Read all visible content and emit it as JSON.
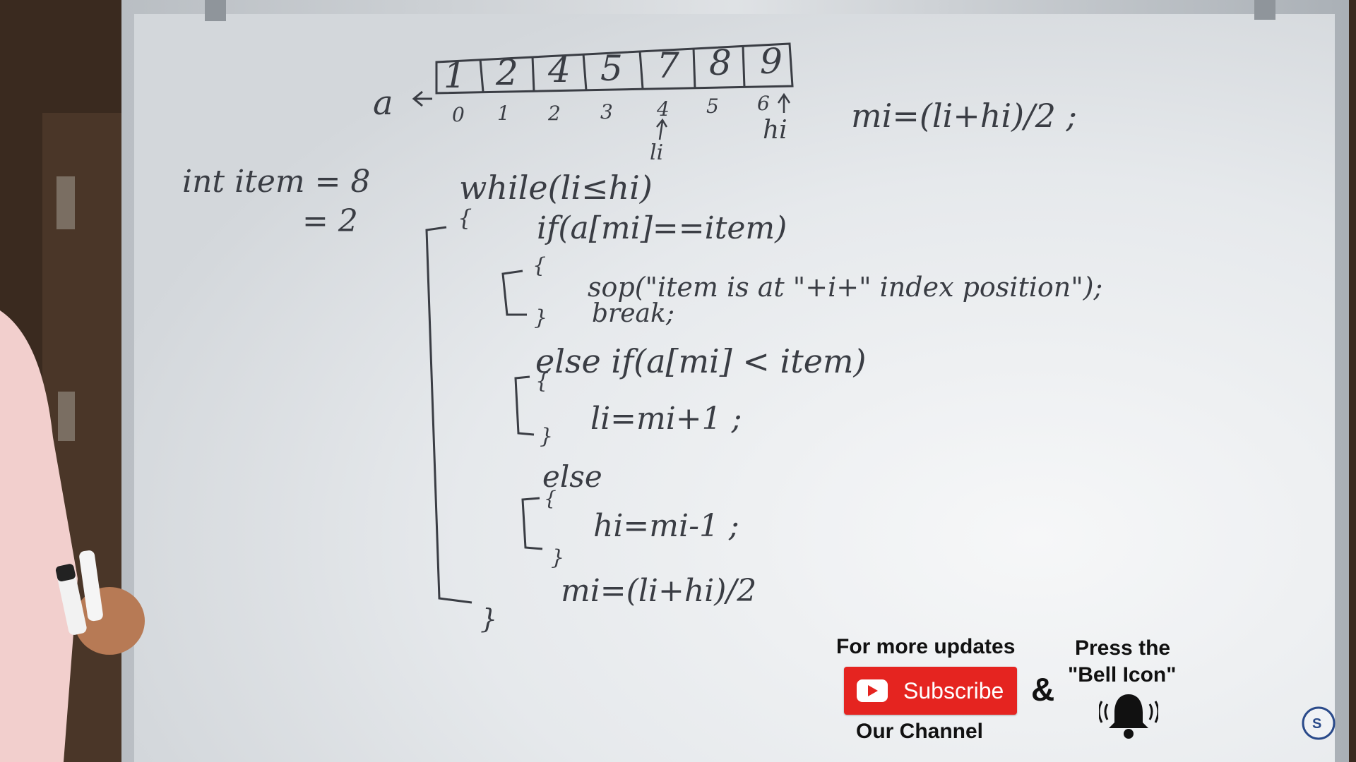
{
  "board": {
    "array_name": "a",
    "array_values": [
      "1",
      "2",
      "4",
      "5",
      "7",
      "8",
      "9"
    ],
    "array_indices": [
      "0",
      "1",
      "2",
      "3",
      "4",
      "5",
      "6"
    ],
    "pointer_li": "li",
    "pointer_hi": "hi",
    "mid_formula": "mi=(li+hi)/2 ;",
    "item_decl": "int item = 8",
    "item_alt": "= 2",
    "code": {
      "while_line": "while(li≤hi)",
      "open_brace": "{",
      "if_line": "if(a[mi]==item)",
      "if_open": "{",
      "sop_line": "sop(\"item is at \"+i+\" index position\");",
      "break_line": "break;",
      "if_close": "}",
      "elseif_line": "else if(a[mi] < item)",
      "elseif_open": "{",
      "li_update": "li=mi+1 ;",
      "elseif_close": "}",
      "else_line": "else",
      "else_open": "{",
      "hi_update": "hi=mi-1 ;",
      "else_close": "}",
      "mid_update": "mi=(li+hi)/2",
      "close_brace": "}"
    }
  },
  "promo": {
    "updates_text": "For more updates",
    "subscribe_label": "Subscribe",
    "channel_text": "Our Channel",
    "ampersand": "&",
    "press_text": "Press the",
    "bell_text": "\"Bell Icon\""
  },
  "icons": {
    "play": "youtube-play-icon",
    "bell": "bell-icon",
    "logo": "channel-logo-icon"
  },
  "colors": {
    "subscribe_red": "#e52420",
    "board_white": "#e9ecef",
    "marker": "#3a3d44"
  }
}
